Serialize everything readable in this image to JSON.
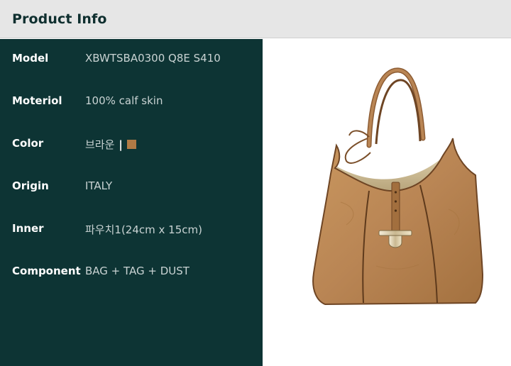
{
  "header": {
    "title": "Product Info"
  },
  "info": {
    "rows": [
      {
        "label": "Model",
        "value": "XBWTSBA0300 Q8E S410"
      },
      {
        "label": "Moteriol",
        "value": "100% calf skin"
      },
      {
        "label": "Color",
        "value": "브라운",
        "separator": "|",
        "swatch_color": "#b07a45"
      },
      {
        "label": "Origin",
        "value": "ITALY"
      },
      {
        "label": "Inner",
        "value": "파우치1(24cm x 15cm)"
      },
      {
        "label": "Component",
        "value": "BAG + TAG + DUST"
      }
    ]
  },
  "product_image": {
    "icon": "tote-bag-photo",
    "color": "#b98554"
  }
}
